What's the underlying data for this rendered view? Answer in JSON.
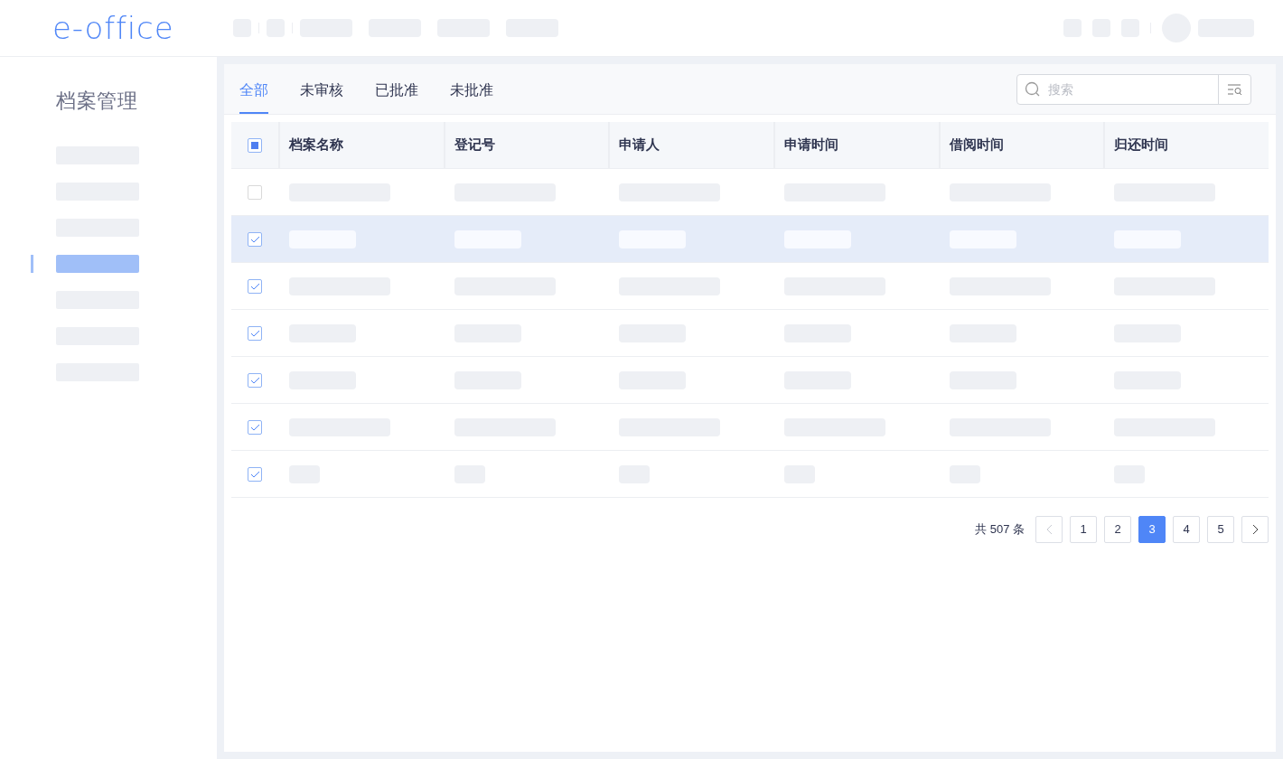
{
  "header": {
    "logo": "e-office"
  },
  "sidebar": {
    "title": "档案管理",
    "items": [
      {
        "selected": false
      },
      {
        "selected": false
      },
      {
        "selected": false
      },
      {
        "selected": true
      },
      {
        "selected": false
      },
      {
        "selected": false
      },
      {
        "selected": false
      }
    ]
  },
  "tabs": [
    {
      "label": "全部",
      "selected": true
    },
    {
      "label": "未审核",
      "selected": false
    },
    {
      "label": "已批准",
      "selected": false
    },
    {
      "label": "未批准",
      "selected": false
    }
  ],
  "search": {
    "placeholder": "搜索"
  },
  "table": {
    "select_all": {
      "checked": true
    },
    "columns": [
      "档案名称",
      "登记号",
      "申请人",
      "申请时间",
      "借阅时间",
      "归还时间"
    ],
    "rows": [
      {
        "checked": false,
        "selected": false,
        "kind": "long"
      },
      {
        "checked": true,
        "selected": true,
        "kind": "medium"
      },
      {
        "checked": true,
        "selected": false,
        "kind": "long"
      },
      {
        "checked": true,
        "selected": false,
        "kind": "medium"
      },
      {
        "checked": true,
        "selected": false,
        "kind": "medium"
      },
      {
        "checked": true,
        "selected": false,
        "kind": "long"
      },
      {
        "checked": true,
        "selected": false,
        "kind": "short"
      }
    ]
  },
  "pagination": {
    "total": "共 507 条",
    "prev": {
      "disabled": true
    },
    "pages": [
      {
        "label": "1",
        "selected": false
      },
      {
        "label": "2",
        "selected": false
      },
      {
        "label": "3",
        "selected": true
      },
      {
        "label": "4",
        "selected": false
      },
      {
        "label": "5",
        "selected": false
      }
    ],
    "next": {
      "disabled": false
    }
  }
}
